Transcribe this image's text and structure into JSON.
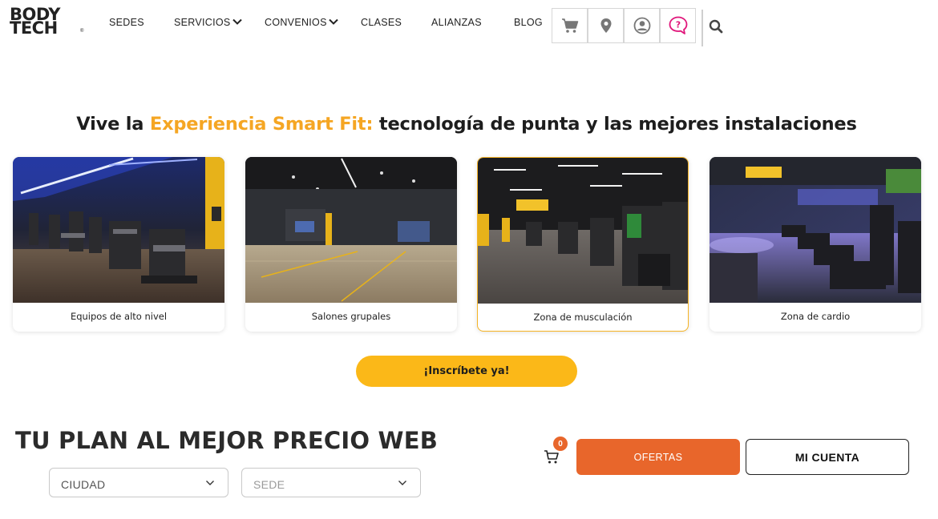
{
  "brand": {
    "line1": "BODY",
    "line2": "TECH",
    "reg": "®"
  },
  "nav": {
    "sedes": "SEDES",
    "servicios": "SERVICIOS",
    "convenios": "CONVENIOS",
    "clases": "CLASES",
    "alianzas": "ALIANZAS",
    "blog": "BLOG"
  },
  "header_icons": [
    "cart-icon",
    "location-pin-icon",
    "user-icon",
    "help-chat-icon",
    "search-icon"
  ],
  "headline": {
    "before": "Vive la ",
    "accent": "Experiencia Smart Fit:",
    "after": " tecnología de punta y las mejores instalaciones"
  },
  "cards": [
    {
      "caption": "Equipos de alto nivel"
    },
    {
      "caption": "Salones grupales"
    },
    {
      "caption": "Zona de musculación",
      "active": true
    },
    {
      "caption": "Zona de cardio"
    }
  ],
  "cta": "¡Inscríbete ya!",
  "plan": {
    "title": "TU PLAN AL MEJOR PRECIO WEB",
    "city_select": "CIUDAD",
    "sede_select": "SEDE"
  },
  "cart": {
    "count": "0"
  },
  "buttons": {
    "ofertas": "OFERTAS",
    "mi_cuenta": "MI CUENTA"
  },
  "colors": {
    "accent_yellow": "#fbb818",
    "accent_orange": "#e8662b",
    "headline_accent": "#f5a623",
    "help_icon": "#e0157a"
  }
}
